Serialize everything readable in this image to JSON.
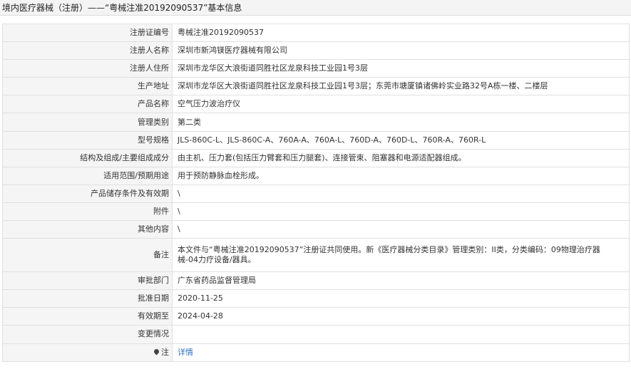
{
  "header": {
    "title": "境内医疗器械（注册）——“粤械注准20192090537”基本信息"
  },
  "rows": [
    {
      "label": "注册证编号",
      "value": "粤械注准20192090537"
    },
    {
      "label": "注册人名称",
      "value": "深圳市新鸿镁医疗器械有限公司"
    },
    {
      "label": "注册人住所",
      "value": "深圳市龙华区大浪街道同胜社区龙泉科技工业园1号3层"
    },
    {
      "label": "生产地址",
      "value": "深圳市龙华区大浪街道同胜社区龙泉科技工业园1号3层；东莞市塘厦镇诸佛岭实业路32号A栋一楼、二楼层"
    },
    {
      "label": "产品名称",
      "value": "空气压力波治疗仪"
    },
    {
      "label": "管理类别",
      "value": "第二类"
    },
    {
      "label": "型号规格",
      "value": "JLS-860C-L、JLS-860C-A、760A-A、760A-L、760D-A、760D-L、760R-A、760R-L"
    },
    {
      "label": "结构及组成/主要组成成分",
      "value": "由主机、压力套(包括压力臂套和压力腿套)、连接管束、阻塞器和电源适配器组成。"
    },
    {
      "label": "适用范围/预期用途",
      "value": "用于预防静脉血栓形成。"
    },
    {
      "label": "产品储存条件及有效期",
      "value": "\\"
    },
    {
      "label": "附件",
      "value": "\\"
    },
    {
      "label": "其他内容",
      "value": "\\"
    },
    {
      "label": "备注",
      "value": "本文件与“粤械注准20192090537”注册证共同使用。新《医疗器械分类目录》管理类别：II类，分类编码：09物理治疗器械-04力疗设备/器具。"
    },
    {
      "label": "审批部门",
      "value": "广东省药品监督管理局"
    },
    {
      "label": "批准日期",
      "value": "2020-11-25"
    },
    {
      "label": "有效期至",
      "value": "2024-04-28"
    },
    {
      "label": "变更情况",
      "value": ""
    }
  ],
  "note": {
    "label": "注",
    "icon": "pin-icon",
    "link_text": "详情",
    "link_color": "#2e6fc2"
  }
}
